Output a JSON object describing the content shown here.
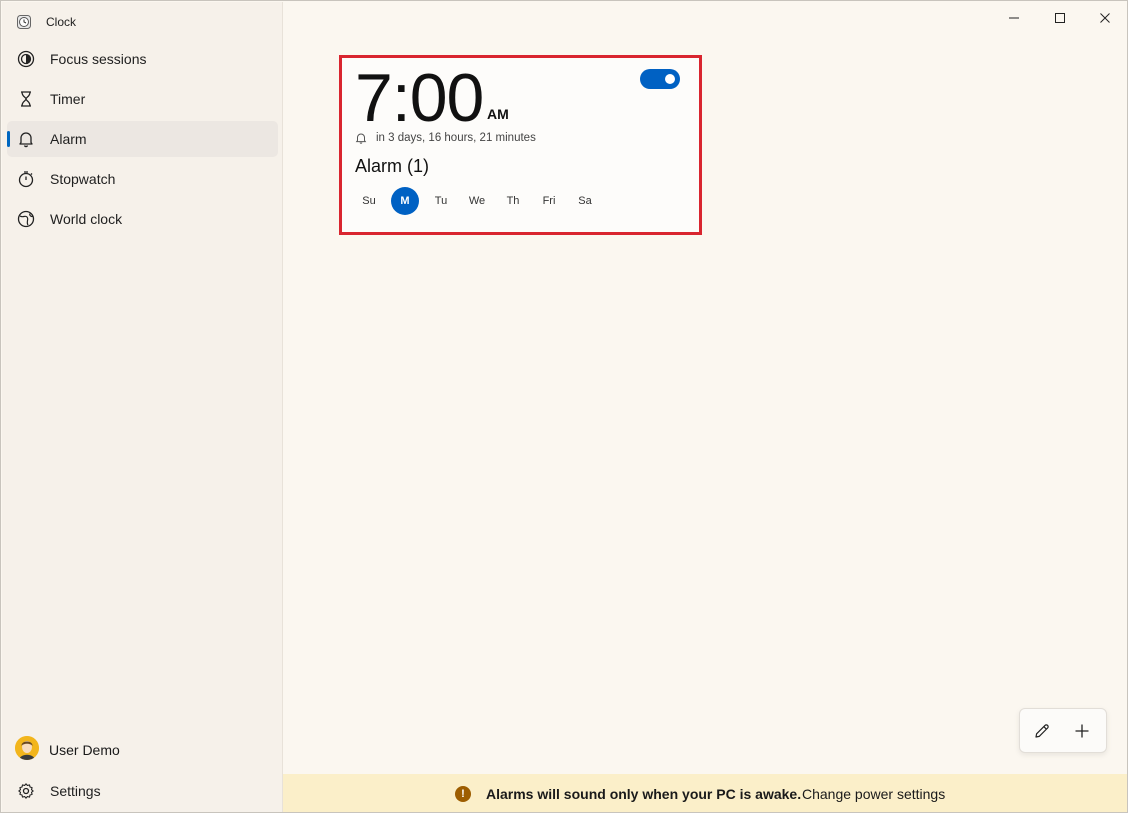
{
  "app": {
    "title": "Clock",
    "icon": "clock-app-icon"
  },
  "window_controls": {
    "minimize": "minimize-icon",
    "maximize": "maximize-icon",
    "close": "close-icon"
  },
  "sidebar": {
    "items": [
      {
        "label": "Focus sessions",
        "icon": "focus-icon",
        "active": false
      },
      {
        "label": "Timer",
        "icon": "hourglass-icon",
        "active": false
      },
      {
        "label": "Alarm",
        "icon": "bell-icon",
        "active": true
      },
      {
        "label": "Stopwatch",
        "icon": "stopwatch-icon",
        "active": false
      },
      {
        "label": "World clock",
        "icon": "globe-icon",
        "active": false
      }
    ],
    "user": {
      "name": "User Demo",
      "icon": "avatar"
    },
    "settings": {
      "label": "Settings",
      "icon": "gear-icon"
    }
  },
  "alarm": {
    "time": "7:00",
    "ampm": "AM",
    "enabled": true,
    "remaining": "in 3 days, 16 hours, 21 minutes",
    "name": "Alarm (1)",
    "days": [
      {
        "label": "Su",
        "selected": false
      },
      {
        "label": "M",
        "selected": true
      },
      {
        "label": "Tu",
        "selected": false
      },
      {
        "label": "We",
        "selected": false
      },
      {
        "label": "Th",
        "selected": false
      },
      {
        "label": "Fri",
        "selected": false
      },
      {
        "label": "Sa",
        "selected": false
      }
    ],
    "accent": "#0061c3",
    "highlight_border": "#d9252f"
  },
  "actions": {
    "edit": "pencil-icon",
    "add": "plus-icon"
  },
  "infobar": {
    "message": "Alarms will sound only when your PC is awake.",
    "link": "Change power settings",
    "icon": "warning-icon",
    "background": "#fbefc9"
  }
}
